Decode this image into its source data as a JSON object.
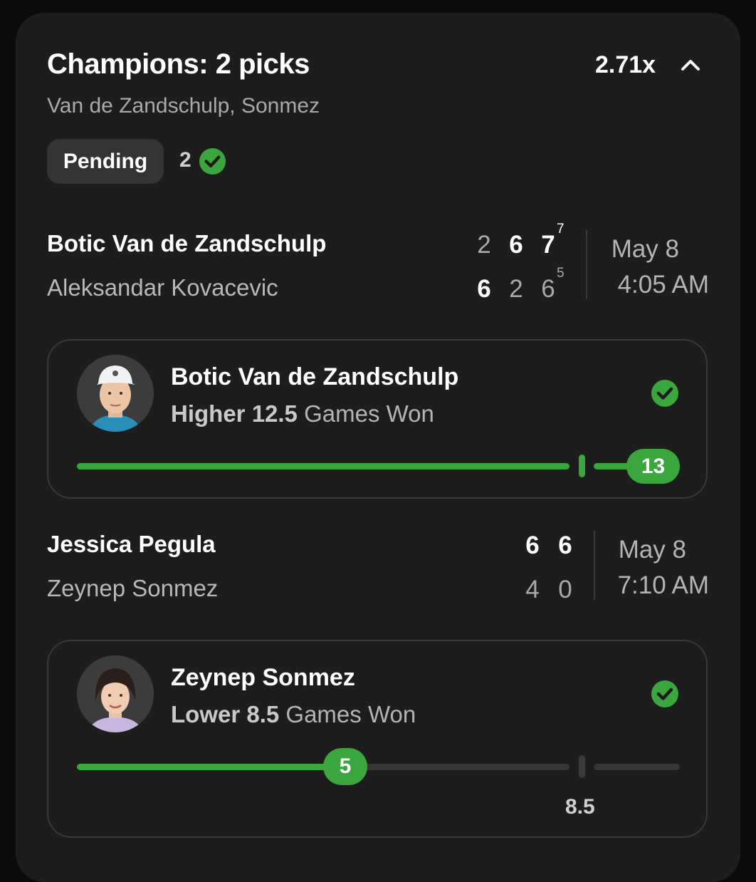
{
  "header": {
    "title": "Champions: 2 picks",
    "multiplier": "2.71x",
    "subtitle": "Van de Zandschulp, Sonmez",
    "status": "Pending",
    "hits_count": "2"
  },
  "matches": [
    {
      "player1": "Botic Van de Zandschulp",
      "player2": "Aleksandar Kovacevic",
      "p1_sets": [
        "2",
        "6",
        "7"
      ],
      "p2_sets": [
        "6",
        "2",
        "6"
      ],
      "p1_tiebreak": "7",
      "p2_tiebreak": "5",
      "date": "May 8",
      "time": "4:05 AM"
    },
    {
      "player1": "Jessica Pegula",
      "player2": "Zeynep Sonmez",
      "p1_sets": [
        "6",
        "6"
      ],
      "p2_sets": [
        "4",
        "0"
      ],
      "date": "May 8",
      "time": "7:10 AM"
    }
  ],
  "picks": [
    {
      "player": "Botic Van de Zandschulp",
      "direction": "Higher",
      "line": "12.5",
      "stat": "Games Won",
      "result": "13",
      "progress_pct": 100,
      "line_pct": 78
    },
    {
      "player": "Zeynep Sonmez",
      "direction": "Lower",
      "line": "8.5",
      "stat": "Games Won",
      "result": "5",
      "progress_pct": 45,
      "line_pct": 84,
      "line_label": "8.5"
    }
  ],
  "colors": {
    "accent_green": "#3aa63d",
    "card_bg": "#1d1d1d",
    "page_bg": "#0b0b0b"
  },
  "icons": {
    "collapse": "chevron-up-icon",
    "check": "check-circle-icon"
  }
}
